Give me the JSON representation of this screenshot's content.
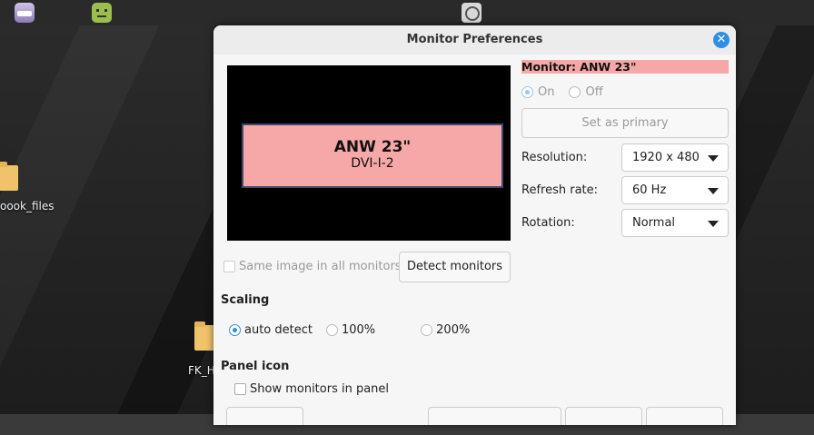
{
  "dialog": {
    "title": "Monitor Preferences",
    "close_glyph": "✕"
  },
  "preview": {
    "monitor_name": "ANW 23\"",
    "monitor_port": "DVI-I-2"
  },
  "monitor_panel": {
    "heading": "Monitor: ANW 23\"",
    "power_on_label": "On",
    "power_off_label": "Off",
    "set_primary_label": "Set as primary",
    "resolution_label": "Resolution:",
    "resolution_value": "1920 x 480",
    "refresh_label": "Refresh rate:",
    "refresh_value": "60 Hz",
    "rotation_label": "Rotation:",
    "rotation_value": "Normal"
  },
  "options": {
    "same_image_label": "Same image in all monitors",
    "detect_monitors_label": "Detect monitors"
  },
  "scaling": {
    "title": "Scaling",
    "auto_label": "auto detect",
    "p100_label": "100%",
    "p200_label": "200%"
  },
  "panel_icon": {
    "title": "Panel icon",
    "show_label": "Show monitors in panel"
  },
  "desktop": {
    "item1_label": "oook_files",
    "item2_label": "FK_H"
  },
  "colors": {
    "accent": "#2f8fe0",
    "monitor_highlight": "#f6a8a8"
  }
}
